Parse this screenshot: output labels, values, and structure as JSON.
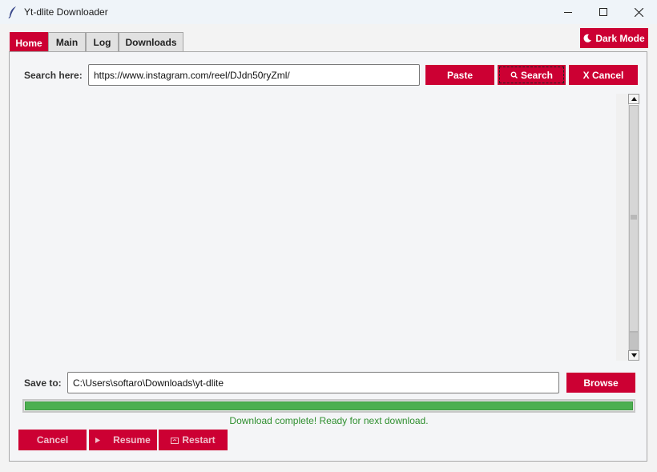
{
  "window": {
    "title": "Yt-dlite Downloader"
  },
  "tabs": [
    {
      "label": "Home",
      "active": true
    },
    {
      "label": "Main",
      "active": false
    },
    {
      "label": "Log",
      "active": false
    },
    {
      "label": "Downloads",
      "active": false
    }
  ],
  "dark_mode": {
    "label": "Dark Mode",
    "icon": "moon-icon"
  },
  "search": {
    "label": "Search here:",
    "value": "https://www.instagram.com/reel/DJdn50ryZml/",
    "paste_label": "Paste",
    "search_label": "Search",
    "search_icon": "magnifier-icon",
    "cancel_label": "X Cancel"
  },
  "save": {
    "label": "Save to:",
    "value": "C:\\Users\\softaro\\Downloads\\yt-dlite",
    "browse_label": "Browse"
  },
  "progress": {
    "fraction": 1.0,
    "color": "#4caf50"
  },
  "status": {
    "text": "Download complete! Ready for next download.",
    "color": "#2f8f2f"
  },
  "controls": {
    "cancel_label": "Cancel",
    "resume_label": "Resume",
    "resume_icon": "play-icon",
    "restart_label": "Restart",
    "restart_icon": "restart-icon"
  },
  "colors": {
    "accent": "#cc0033"
  }
}
